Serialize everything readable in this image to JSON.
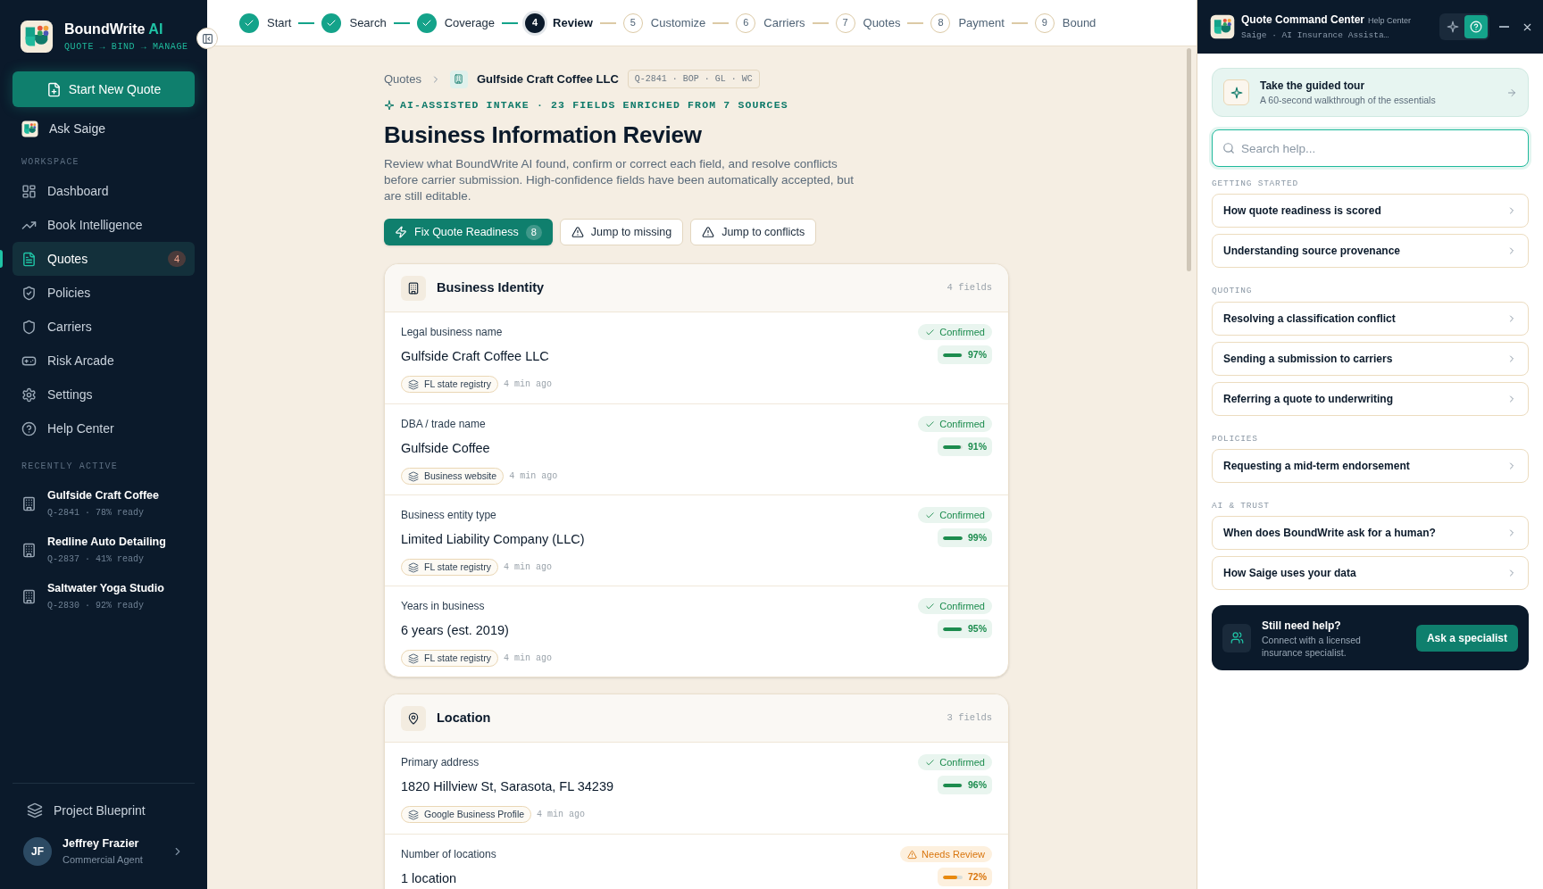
{
  "sidebar": {
    "brand": {
      "name": "BoundWrite",
      "accent": "AI",
      "tagline": "QUOTE → BIND → MANAGE"
    },
    "primary_button": "Start New Quote",
    "assistant": "Ask Saige",
    "workspace": {
      "heading": "WORKSPACE",
      "items": [
        {
          "label": "Dashboard",
          "selected": false
        },
        {
          "label": "Book Intelligence",
          "selected": false
        },
        {
          "label": "Quotes",
          "selected": true,
          "badge": "4"
        },
        {
          "label": "Policies",
          "selected": false
        },
        {
          "label": "Carriers",
          "selected": false
        },
        {
          "label": "Risk Arcade",
          "selected": false
        },
        {
          "label": "Settings",
          "selected": false
        },
        {
          "label": "Help Center",
          "selected": false
        }
      ]
    },
    "recent": {
      "heading": "RECENTLY ACTIVE",
      "items": [
        {
          "name": "Gulfside Craft Coffee",
          "meta": "Q-2841 · 78% ready"
        },
        {
          "name": "Redline Auto Detailing",
          "meta": "Q-2837 · 41% ready"
        },
        {
          "name": "Saltwater Yoga Studio",
          "meta": "Q-2830 · 92% ready"
        }
      ]
    },
    "footer_link": "Project Blueprint",
    "user": {
      "initials": "JF",
      "name": "Jeffrey Frazier",
      "role": "Commercial Agent"
    }
  },
  "stepper": [
    {
      "label": "Start",
      "kind": "done"
    },
    {
      "label": "Search",
      "kind": "done"
    },
    {
      "label": "Coverage",
      "kind": "done"
    },
    {
      "label": "Review",
      "number": "4",
      "kind": "current"
    },
    {
      "label": "Customize",
      "number": "5",
      "kind": "upcoming"
    },
    {
      "label": "Carriers",
      "number": "6",
      "kind": "upcoming"
    },
    {
      "label": "Quotes",
      "number": "7",
      "kind": "upcoming"
    },
    {
      "label": "Payment",
      "number": "8",
      "kind": "upcoming"
    },
    {
      "label": "Bound",
      "number": "9",
      "kind": "upcoming"
    }
  ],
  "breadcrumb": {
    "root": "Quotes",
    "current": "Gulfside Craft Coffee LLC",
    "tag": "Q-2841 · BOP · GL · WC"
  },
  "eyebrow": "AI-ASSISTED INTAKE · 23 FIELDS ENRICHED FROM 7 SOURCES",
  "title": "Business Information Review",
  "description": "Review what BoundWrite AI found, confirm or correct each field, and resolve conflicts before carrier submission. High-confidence fields have been automatically accepted, but are still editable.",
  "actions": [
    {
      "label": "Fix Quote Readiness",
      "kind": "primary",
      "count": "8"
    },
    {
      "label": "Jump to missing",
      "kind": "secondary"
    },
    {
      "label": "Jump to conflicts",
      "kind": "secondary"
    }
  ],
  "sections": [
    {
      "title": "Business Identity",
      "count": "4 fields",
      "fields": [
        {
          "label": "Legal business name",
          "value": "Gulfside Craft Coffee LLC",
          "status": "Confirmed",
          "kind": "confirmed",
          "level": 0.97,
          "reading": "97%",
          "source": "FL state registry",
          "time": "4 min ago"
        },
        {
          "label": "DBA / trade name",
          "value": "Gulfside Coffee",
          "status": "Confirmed",
          "kind": "confirmed",
          "level": 0.91,
          "reading": "91%",
          "source": "Business website",
          "time": "4 min ago"
        },
        {
          "label": "Business entity type",
          "value": "Limited Liability Company (LLC)",
          "status": "Confirmed",
          "kind": "confirmed",
          "level": 0.99,
          "reading": "99%",
          "source": "FL state registry",
          "time": "4 min ago"
        },
        {
          "label": "Years in business",
          "value": "6 years (est. 2019)",
          "status": "Confirmed",
          "kind": "confirmed",
          "level": 0.95,
          "reading": "95%",
          "source": "FL state registry",
          "time": "4 min ago"
        }
      ]
    },
    {
      "title": "Location",
      "count": "3 fields",
      "fields": [
        {
          "label": "Primary address",
          "value": "1820 Hillview St, Sarasota, FL 34239",
          "status": "Confirmed",
          "kind": "confirmed",
          "level": 0.96,
          "reading": "96%",
          "source": "Google Business Profile",
          "time": "4 min ago"
        },
        {
          "label": "Number of locations",
          "value": "1 location",
          "status": "Needs Review",
          "kind": "review",
          "level": 0.72,
          "reading": "72%"
        }
      ]
    }
  ],
  "help_panel": {
    "title": "Quote Command Center",
    "badge": "Help Center",
    "subtitle": "Saige · AI Insurance Assista…",
    "modes": [
      {
        "selected": false
      },
      {
        "selected": true
      }
    ],
    "tour": {
      "title": "Take the guided tour",
      "subtitle": "A 60-second walkthrough of the essentials"
    },
    "search": {
      "placeholder": "Search help..."
    },
    "groups": [
      {
        "heading": "GETTING STARTED",
        "items": [
          "How quote readiness is scored",
          "Understanding source provenance"
        ]
      },
      {
        "heading": "QUOTING",
        "items": [
          "Resolving a classification conflict",
          "Sending a submission to carriers",
          "Referring a quote to underwriting"
        ]
      },
      {
        "heading": "POLICIES",
        "items": [
          "Requesting a mid-term endorsement"
        ]
      },
      {
        "heading": "AI & TRUST",
        "items": [
          "When does BoundWrite ask for a human?",
          "How Saige uses your data"
        ]
      }
    ],
    "cta": {
      "title": "Still need help?",
      "text": "Connect with a licensed insurance specialist.",
      "button": "Ask a specialist"
    }
  }
}
